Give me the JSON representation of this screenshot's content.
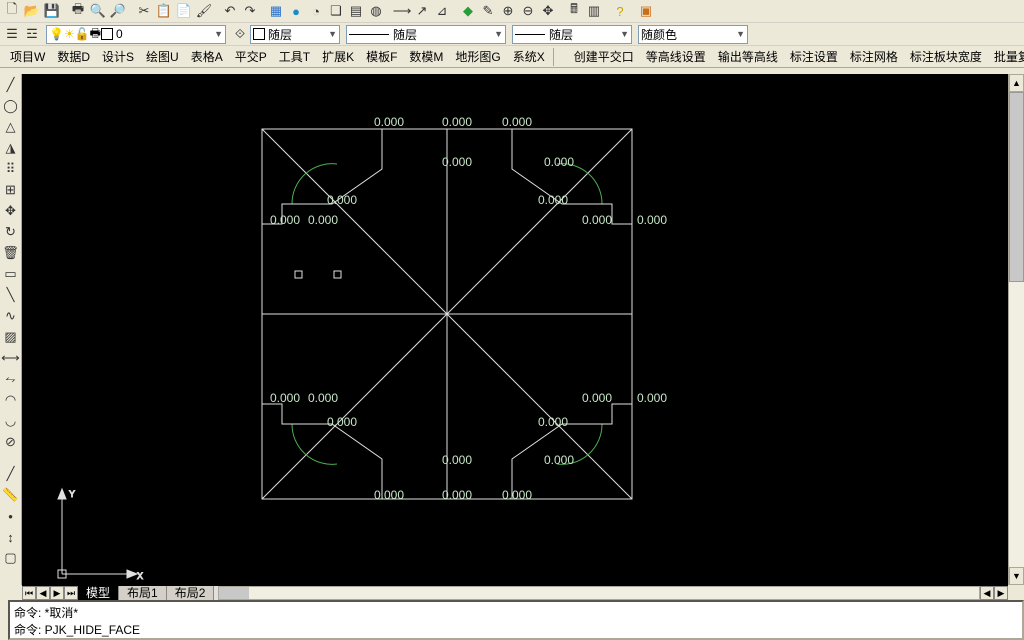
{
  "toolbar1": {
    "icons": [
      "new-file",
      "open",
      "save",
      "print",
      "preview",
      "find",
      "",
      "cut",
      "copy",
      "paste",
      "format-painter",
      "",
      "undo",
      "redo",
      "",
      "hatch",
      "global",
      "clip",
      "multi-hatch",
      "layers",
      "donut",
      "",
      "dim-style",
      "leader",
      "length",
      "",
      "block",
      "edit-block",
      "rotate",
      "zoom-ext",
      "zoom-win",
      "",
      "calc",
      "props",
      "",
      "help",
      "",
      "exit"
    ]
  },
  "row2": {
    "layer_state": "0",
    "by_layer": "随层",
    "by_color": "随颜色",
    "swatch": "#ffffff"
  },
  "menu": [
    "项目W",
    "数据D",
    "设计S",
    "绘图U",
    "表格A",
    "平交P",
    "工具T",
    "扩展K",
    "模板F",
    "数模M",
    "地形图G",
    "系统X"
  ],
  "menu_r": [
    "创建平交口",
    "等高线设置",
    "输出等高线",
    "标注设置",
    "标注网格",
    "标注板块宽度",
    "批量复制"
  ],
  "left_tools": [
    "line",
    "construction",
    "polyline",
    "mirror",
    "array",
    "shell",
    "move",
    "rotate-cw",
    "erase",
    "rectangle",
    "line2",
    "spline",
    "hatch2",
    "dim",
    "dim2",
    "arc",
    "arc2",
    "break",
    "",
    "line3",
    "measure",
    "point",
    "move2",
    "region"
  ],
  "tabs": {
    "active": "模型",
    "others": [
      "布局1",
      "布局2"
    ]
  },
  "cmd": {
    "l1": "命令: *取消*",
    "l2": "命令: PJK_HIDE_FACE",
    "prompt": "命令:"
  },
  "dims": {
    "label": "0.000"
  },
  "ucs": {
    "x": "X",
    "y": "Y"
  }
}
